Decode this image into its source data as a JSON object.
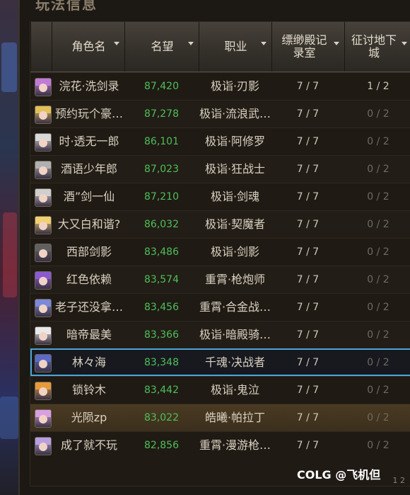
{
  "window": {
    "title": "玩法信息"
  },
  "columns": [
    {
      "label": "角色名"
    },
    {
      "label": "名望"
    },
    {
      "label": "职业"
    },
    {
      "label": "缥缈殿记录室"
    },
    {
      "label": "征讨地下城"
    }
  ],
  "rows": [
    {
      "name": "浣花·洗剑录",
      "fame": "87,420",
      "job": "极诣·刃影",
      "a": "7 / 7",
      "b": "1 / 2",
      "hair": "#c27ad9",
      "state": "normal"
    },
    {
      "name": "预约玩个豪…",
      "fame": "87,278",
      "job": "极诣·流浪武…",
      "a": "7 / 7",
      "b": "0 / 2",
      "hair": "#e2c05a",
      "state": "alt"
    },
    {
      "name": "时·透无一郎",
      "fame": "86,101",
      "job": "极诣·阿修罗",
      "a": "7 / 7",
      "b": "0 / 2",
      "hair": "#d9d9d9",
      "state": "normal"
    },
    {
      "name": "酒语少年郎",
      "fame": "87,023",
      "job": "极诣·狂战士",
      "a": "7 / 7",
      "b": "0 / 2",
      "hair": "#b0b0b0",
      "state": "alt"
    },
    {
      "name": "酒”剑一仙",
      "fame": "87,210",
      "job": "极诣·剑魂",
      "a": "7 / 7",
      "b": "0 / 2",
      "hair": "#cfcfcf",
      "state": "normal"
    },
    {
      "name": "大又白和谐?",
      "fame": "86,032",
      "job": "极诣·契魔者",
      "a": "7 / 7",
      "b": "0 / 2",
      "hair": "#f0d070",
      "state": "alt"
    },
    {
      "name": "西部剑影",
      "fame": "83,486",
      "job": "极诣·剑影",
      "a": "7 / 7",
      "b": "0 / 2",
      "hair": "#606060",
      "state": "normal"
    },
    {
      "name": "红色依赖",
      "fame": "83,574",
      "job": "重霄·枪炮师",
      "a": "7 / 7",
      "b": "0 / 2",
      "hair": "#8a5ad0",
      "state": "alt"
    },
    {
      "name": "老子还没拿…",
      "fame": "83,456",
      "job": "重霄·合金战…",
      "a": "7 / 7",
      "b": "0 / 2",
      "hair": "#7a8ad8",
      "state": "normal"
    },
    {
      "name": "暗帝最美",
      "fame": "83,366",
      "job": "极诣·暗殿骑…",
      "a": "7 / 7",
      "b": "0 / 2",
      "hair": "#e8e8e8",
      "state": "alt"
    },
    {
      "name": "林々海",
      "fame": "83,348",
      "job": "千魂·决战者",
      "a": "7 / 7",
      "b": "0 / 2",
      "hair": "#5a6ac8",
      "state": "sel"
    },
    {
      "name": "锁铃木",
      "fame": "83,442",
      "job": "极诣·鬼泣",
      "a": "7 / 7",
      "b": "0 / 2",
      "hair": "#e89a3a",
      "state": "normal"
    },
    {
      "name": "光陨zp",
      "fame": "83,022",
      "job": "皓曦·帕拉丁",
      "a": "7 / 7",
      "b": "0 / 2",
      "hair": "#d9a0e0",
      "state": "hl"
    },
    {
      "name": "成了就不玩",
      "fame": "82,856",
      "job": "重霄·漫游枪…",
      "a": "7 / 7",
      "b": "0 / 2",
      "hair": "#b8a0e0",
      "state": "normal"
    }
  ],
  "footer": {
    "pager": "1 2"
  },
  "watermark": "COLG @飞机但"
}
